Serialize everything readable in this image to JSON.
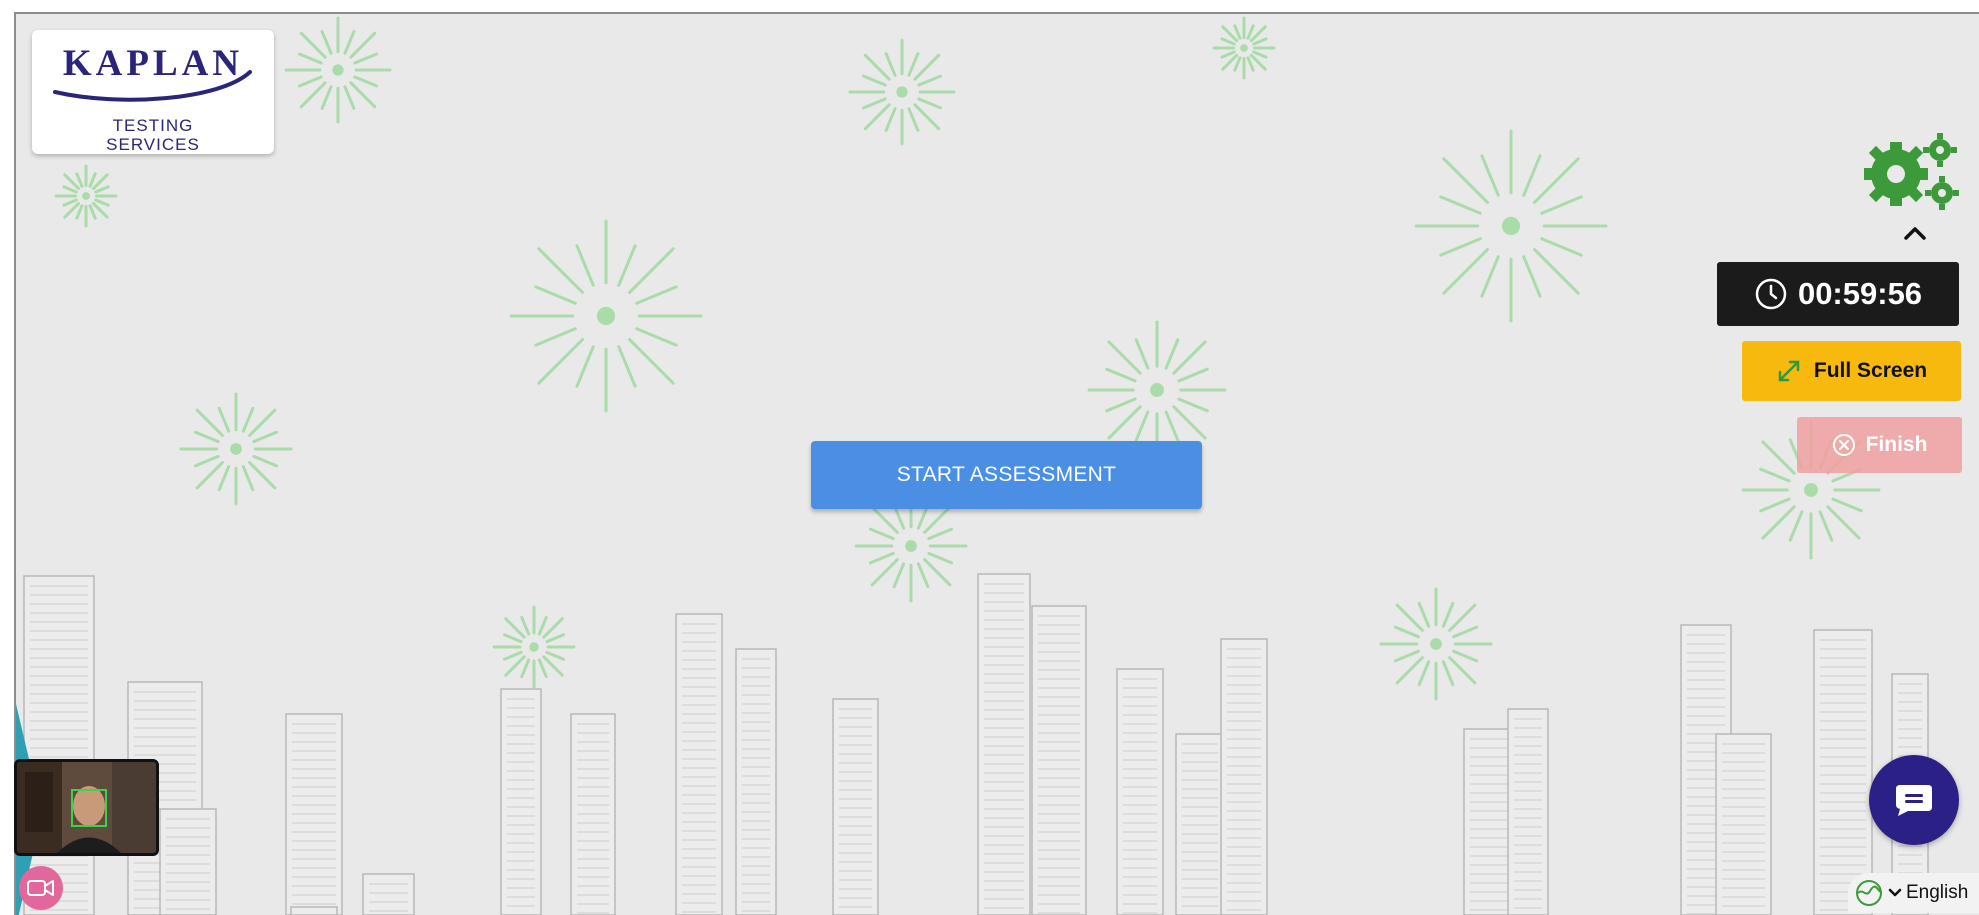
{
  "logo": {
    "name": "KAPLAN",
    "line1": "TESTING",
    "line2": "SERVICES"
  },
  "main": {
    "start_label": "START ASSESSMENT"
  },
  "controls": {
    "timer": "00:59:56",
    "fullscreen_label": "Full Screen",
    "finish_label": "Finish"
  },
  "footer": {
    "language": "English"
  },
  "icons": {
    "settings": "gears-icon",
    "collapse": "chevron-up-icon",
    "timer": "clock-icon",
    "fullscreen": "expand-icon",
    "finish": "close-circle-icon",
    "camera": "video-camera-icon",
    "chat": "chat-icon",
    "language": "globe-icon",
    "language_dropdown": "chevron-down-icon"
  },
  "colors": {
    "start_button": "#4a8fe3",
    "timer_bg": "#1b1b1b",
    "fullscreen_button": "#f7b90e",
    "finish_button": "#f0a0a0",
    "gears": "#3d9a3a",
    "chat_button": "#2a2086",
    "brand": "#2a2578"
  }
}
